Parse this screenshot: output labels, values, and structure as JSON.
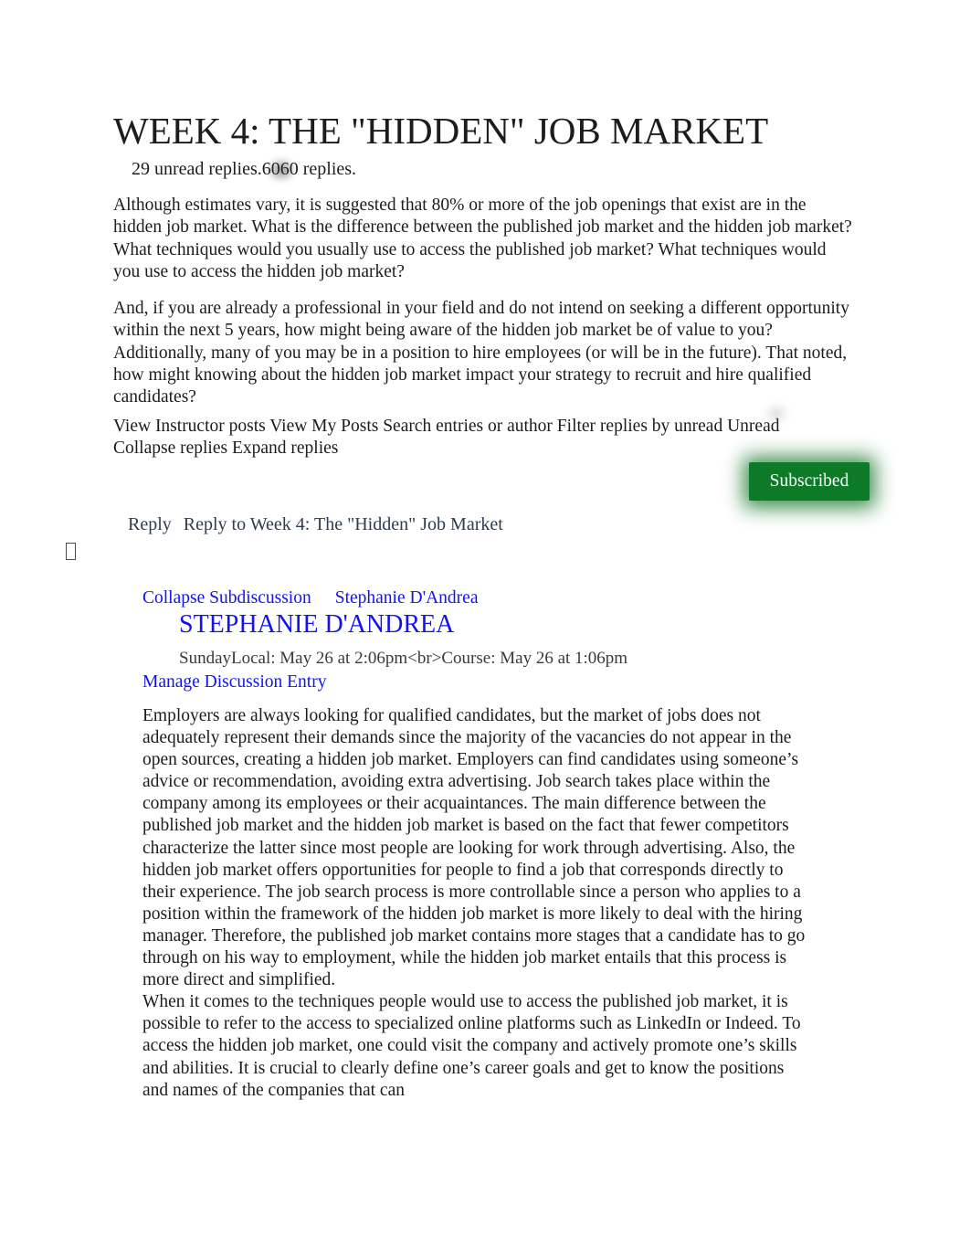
{
  "discussion": {
    "title": "WEEK 4: THE \"HIDDEN\" JOB MARKET",
    "reply_counts": "29 unread replies.6060 replies.",
    "prompt_paragraph_1": "Although estimates vary, it is suggested that 80% or more of the job openings that exist are in the hidden  job market. What is the difference between the published  job market and the hidden job market? What techniques would you usually use to access the published job market? What techniques would you use to access the hidden job market?",
    "prompt_paragraph_2": "And, if you are already a professional in your field and do not intend on seeking a different opportunity within the next 5 years, how might being aware of the hidden job market be of value to you? Additionally, many of you may be in a position to hire employees (or will be in the future). That noted, how might knowing about the hidden job market impact your strategy to recruit and hire qualified candidates?"
  },
  "toolbar": {
    "text": "View Instructor posts View My Posts Search entries or author Filter replies by unread Unread Collapse replies Expand replies",
    "items": [
      "View Instructor posts",
      "View My Posts",
      "Search entries or author",
      "Filter replies by unread",
      "Unread",
      "Collapse replies",
      "Expand replies"
    ],
    "subscribe_label": "Subscribed",
    "subscribe_color": "#0d7a28"
  },
  "reply_bar": {
    "reply_label": "Reply",
    "reply_target": "Reply to Week 4: The \"Hidden\" Job Market"
  },
  "entry": {
    "collapse_label": "Collapse Subdiscussion",
    "author_link": "Stephanie D'Andrea",
    "author_heading": "STEPHANIE D'ANDREA",
    "timestamp": "SundayLocal: May 26 at 2:06pm<br>Course: May 26 at 1:06pm",
    "manage_label": "Manage Discussion Entry",
    "link_color": "#1313f0",
    "body_paragraph_1": "Employers are always looking for qualified candidates, but the market of jobs does not adequately represent their demands since the majority of the vacancies do not appear in the open sources, creating a hidden job market. Employers can find candidates using someone’s advice or recommendation, avoiding extra advertising. Job search takes place within the company among its employees or their acquaintances. The main difference between the published job market and the hidden job market is based on the fact that fewer competitors characterize the latter since most people are looking for work through advertising. Also, the hidden job market offers opportunities for people to find a job that corresponds directly to their experience. The job search process is more controllable since a person who applies to a position within the framework of the hidden job market is more likely to deal with the hiring manager. Therefore, the published job market contains more stages that a candidate has to go through on his way to employment, while the hidden job market entails that this process is more direct and simplified.",
    "body_paragraph_2": "When it comes to the techniques people would use to access the published job market, it is possible to refer to the access to specialized online platforms such as LinkedIn or Indeed. To access the hidden job market, one could visit the company and actively promote one’s skills and abilities. It is crucial to clearly define one’s career goals and get to know the positions and names of the companies that can"
  }
}
